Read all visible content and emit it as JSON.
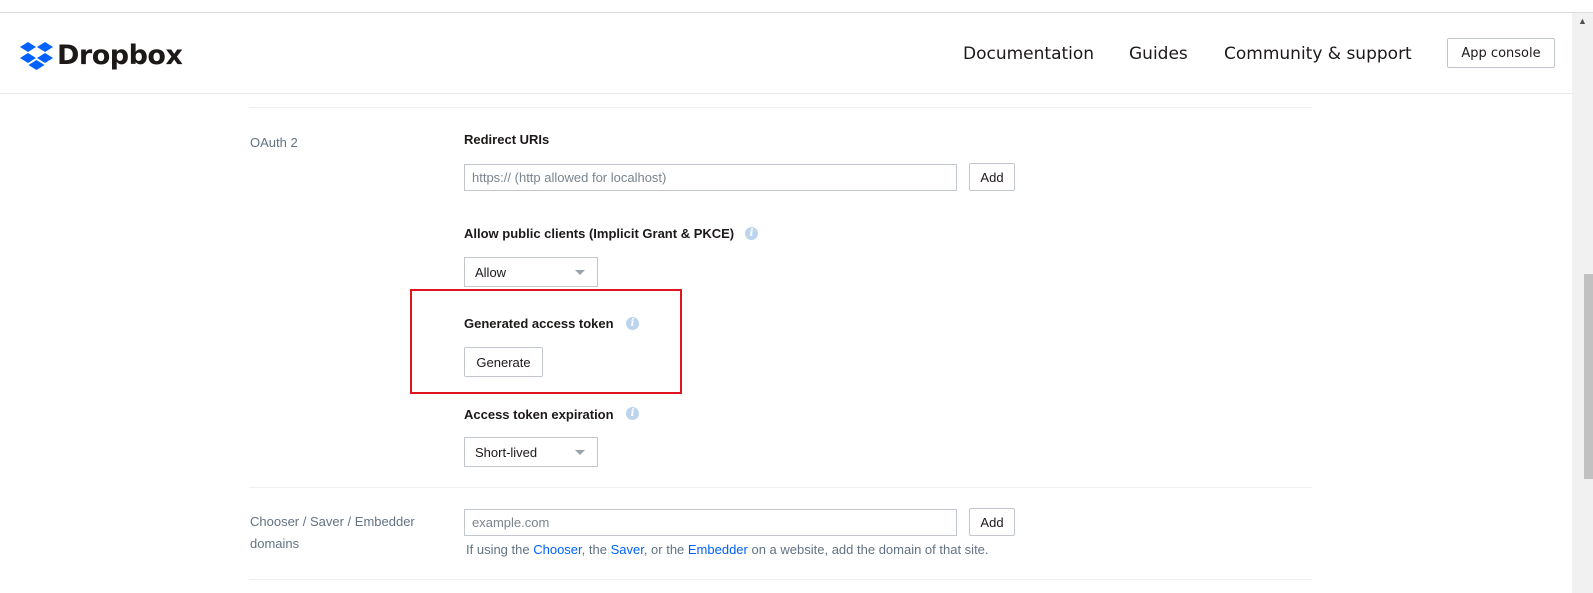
{
  "header": {
    "brand": "Dropbox",
    "nav": {
      "documentation": "Documentation",
      "guides": "Guides",
      "community": "Community & support"
    },
    "app_console": "App console"
  },
  "oauth": {
    "section_label": "OAuth 2",
    "redirect_uris": {
      "label": "Redirect URIs",
      "placeholder": "https:// (http allowed for localhost)",
      "add_label": "Add"
    },
    "public_clients": {
      "label": "Allow public clients (Implicit Grant & PKCE)",
      "selected": "Allow"
    },
    "generated_token": {
      "label": "Generated access token",
      "button_label": "Generate"
    },
    "token_expiration": {
      "label": "Access token expiration",
      "selected": "Short-lived"
    }
  },
  "domains": {
    "section_label_line1": "Chooser / Saver / Embedder",
    "section_label_line2": "domains",
    "placeholder": "example.com",
    "add_label": "Add",
    "help": {
      "prefix": "If using the ",
      "chooser": "Chooser",
      "sep1": ", the ",
      "saver": "Saver",
      "sep2": ", or the ",
      "embedder": "Embedder",
      "suffix": " on a website, add the domain of that site."
    }
  },
  "colors": {
    "brand_blue": "#0061fe",
    "highlight_red": "#e0141e",
    "info_icon": "#bcd4ec"
  },
  "icons": [
    "dropbox-logo-icon",
    "info-icon",
    "chevron-down-icon"
  ]
}
